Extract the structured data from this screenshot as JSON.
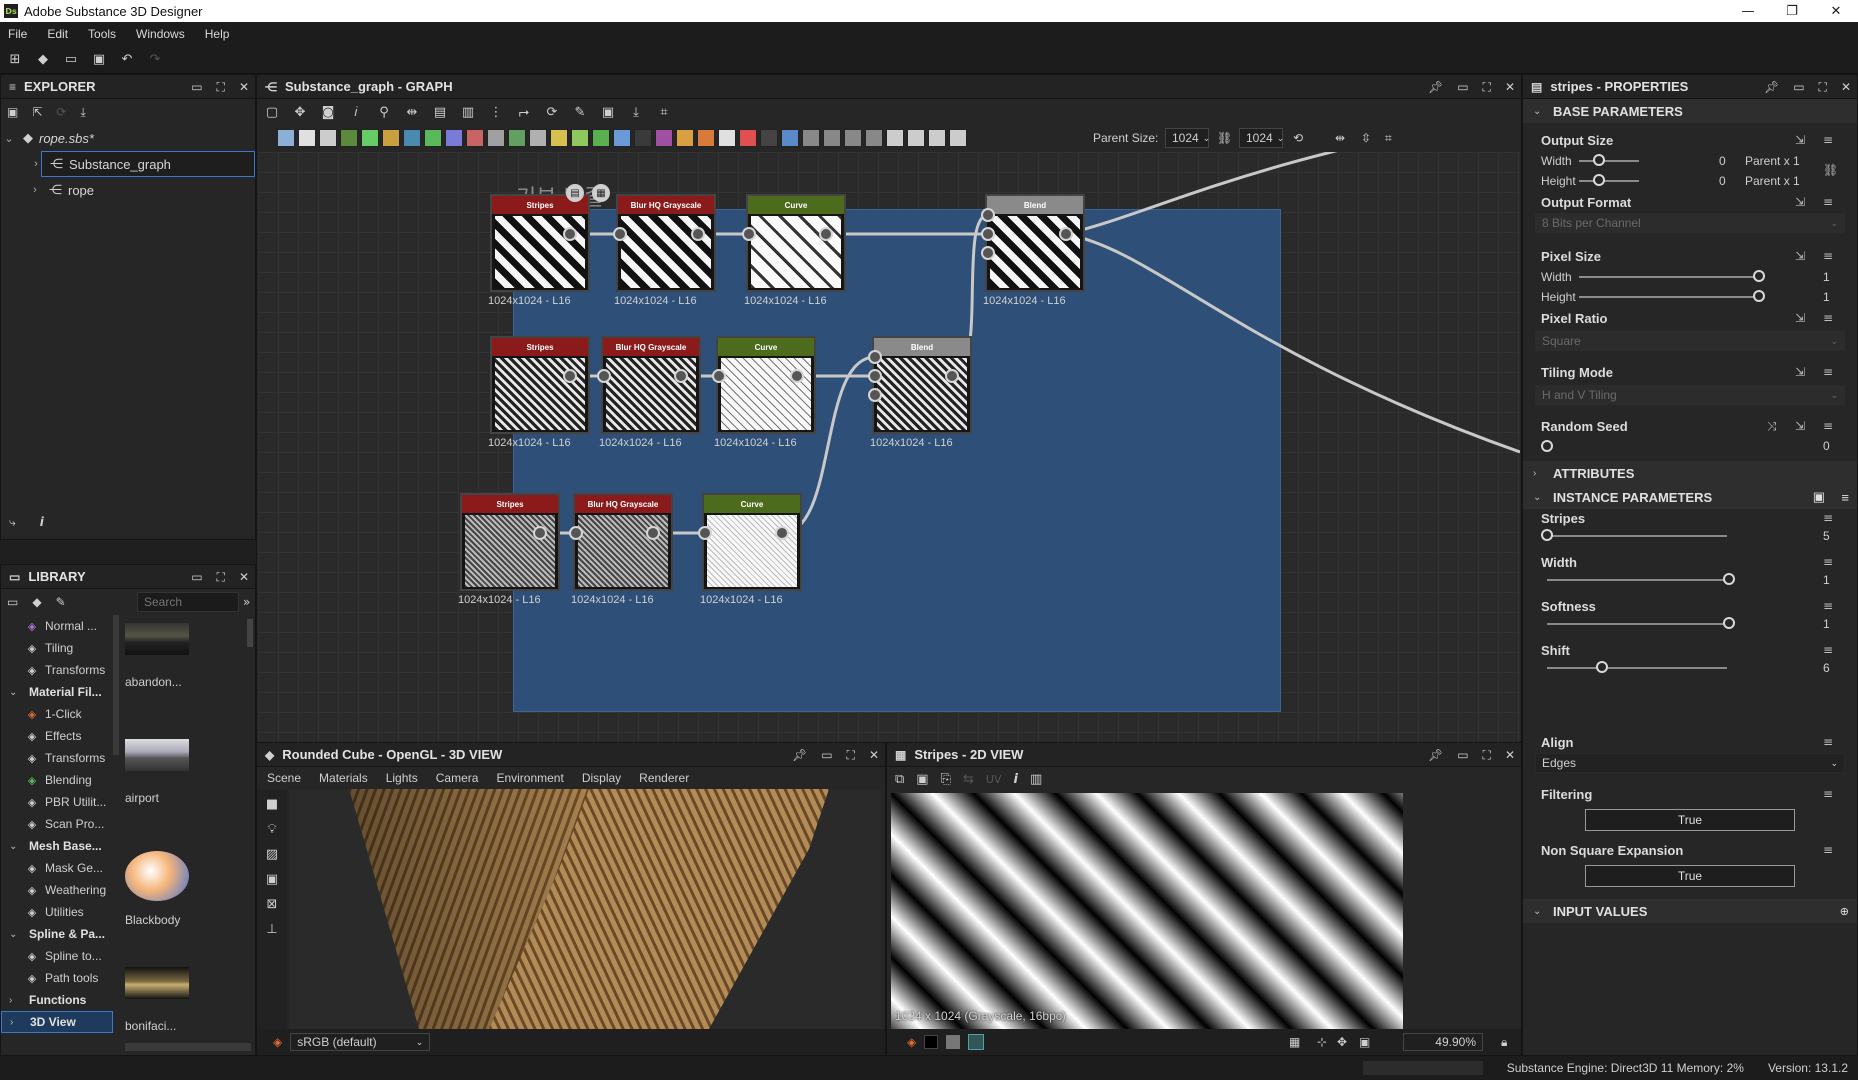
{
  "window": {
    "title": "Adobe Substance 3D Designer",
    "app_badge": "Ds",
    "minimize": "—",
    "restore": "❐",
    "close": "✕"
  },
  "menu": [
    "File",
    "Edit",
    "Tools",
    "Windows",
    "Help"
  ],
  "explorer": {
    "title": "EXPLORER",
    "package": "rope.sbs*",
    "items": [
      "Substance_graph",
      "rope"
    ]
  },
  "library": {
    "title": "LIBRARY",
    "search_placeholder": "Search",
    "categories": [
      {
        "label": "Normal ...",
        "type": "item",
        "color": "#a874d8"
      },
      {
        "label": "Tiling",
        "type": "item",
        "color": "#cfcfcf"
      },
      {
        "label": "Transforms",
        "type": "item",
        "color": "#cfcfcf"
      },
      {
        "label": "Material Fil...",
        "type": "cat"
      },
      {
        "label": "1-Click",
        "type": "item",
        "color": "#d66a3c"
      },
      {
        "label": "Effects",
        "type": "item",
        "color": "#cfcfcf"
      },
      {
        "label": "Transforms",
        "type": "item",
        "color": "#cfcfcf"
      },
      {
        "label": "Blending",
        "type": "item",
        "color": "#5ab85c"
      },
      {
        "label": "PBR Utilit...",
        "type": "item",
        "color": "#cfcfcf"
      },
      {
        "label": "Scan Pro...",
        "type": "item",
        "color": "#cfcfcf"
      },
      {
        "label": "Mesh Base...",
        "type": "cat"
      },
      {
        "label": "Mask Ge...",
        "type": "item",
        "color": "#cfcfcf"
      },
      {
        "label": "Weathering",
        "type": "item",
        "color": "#cfcfcf"
      },
      {
        "label": "Utilities",
        "type": "item",
        "color": "#cfcfcf"
      },
      {
        "label": "Spline & Pa...",
        "type": "cat"
      },
      {
        "label": "Spline to...",
        "type": "item",
        "color": "#cfcfcf"
      },
      {
        "label": "Path tools",
        "type": "item",
        "color": "#cfcfcf"
      },
      {
        "label": "Functions",
        "type": "cat"
      },
      {
        "label": "3D View",
        "type": "cat"
      }
    ],
    "thumbs": [
      "abandon...",
      "airport",
      "Blackbody",
      "bonifaci..."
    ]
  },
  "graph": {
    "title": "Substance_graph - GRAPH",
    "parent_size_label": "Parent Size:",
    "parent_size_w": "1024",
    "parent_size_h": "1024",
    "frame_title": "기본 밧줄",
    "nodes": [
      {
        "id": "n1",
        "title": "Stripes",
        "color": "#8b1a1a",
        "label": "1024x1024 - L16",
        "pattern": "coarse"
      },
      {
        "id": "n2",
        "title": "Blur HQ Grayscale",
        "color": "#8b1a1a",
        "label": "1024x1024 - L16",
        "pattern": "coarse"
      },
      {
        "id": "n3",
        "title": "Curve",
        "color": "#4d6b1c",
        "label": "1024x1024 - L16",
        "pattern": "curve"
      },
      {
        "id": "n4",
        "title": "Blend",
        "color": "#8a8a8a",
        "label": "1024x1024 - L16",
        "pattern": "coarse"
      },
      {
        "id": "n5",
        "title": "Stripes",
        "color": "#8b1a1a",
        "label": "1024x1024 - L16",
        "pattern": "fine"
      },
      {
        "id": "n6",
        "title": "Blur HQ Grayscale",
        "color": "#8b1a1a",
        "label": "1024x1024 - L16",
        "pattern": "fine"
      },
      {
        "id": "n7",
        "title": "Curve",
        "color": "#4d6b1c",
        "label": "1024x1024 - L16",
        "pattern": "fine-curve"
      },
      {
        "id": "n8",
        "title": "Blend",
        "color": "#8a8a8a",
        "label": "1024x1024 - L16",
        "pattern": "fine"
      },
      {
        "id": "n9",
        "title": "Stripes",
        "color": "#8b1a1a",
        "label": "1024x1024 - L16",
        "pattern": "tiny"
      },
      {
        "id": "n10",
        "title": "Blur HQ Grayscale",
        "color": "#8b1a1a",
        "label": "1024x1024 - L16",
        "pattern": "tiny"
      },
      {
        "id": "n11",
        "title": "Curve",
        "color": "#4d6b1c",
        "label": "1024x1024 - L16",
        "pattern": "tiny-curve"
      }
    ]
  },
  "view3d": {
    "title": "Rounded Cube - OpenGL - 3D VIEW",
    "tabs": [
      "Scene",
      "Materials",
      "Lights",
      "Camera",
      "Environment",
      "Display",
      "Renderer"
    ],
    "colorspace": "sRGB (default)"
  },
  "view2d": {
    "title": "Stripes - 2D VIEW",
    "uv_label": "UV",
    "info": "1024 x 1024 (Grayscale, 16bpc)",
    "zoom": "49.90%"
  },
  "properties": {
    "title": "stripes - PROPERTIES",
    "sections": {
      "base": "BASE PARAMETERS",
      "attributes": "ATTRIBUTES",
      "instance": "INSTANCE PARAMETERS",
      "input": "INPUT VALUES"
    },
    "output_size": {
      "label": "Output Size",
      "width_label": "Width",
      "height_label": "Height",
      "width_val": "0",
      "height_val": "0",
      "width_mode": "Parent x 1",
      "height_mode": "Parent x 1"
    },
    "output_format": {
      "label": "Output Format",
      "value": "8 Bits per Channel"
    },
    "pixel_size": {
      "label": "Pixel Size",
      "width_label": "Width",
      "height_label": "Height",
      "width_val": "1",
      "height_val": "1"
    },
    "pixel_ratio": {
      "label": "Pixel Ratio",
      "value": "Square"
    },
    "tiling_mode": {
      "label": "Tiling Mode",
      "value": "H and V Tiling"
    },
    "random_seed": {
      "label": "Random Seed",
      "value": "0"
    },
    "stripes": {
      "label": "Stripes",
      "value": "5",
      "fraction": 0.0
    },
    "width": {
      "label": "Width",
      "value": "1",
      "fraction": 1.0
    },
    "softness": {
      "label": "Softness",
      "value": "1",
      "fraction": 1.0
    },
    "shift": {
      "label": "Shift",
      "value": "6",
      "fraction": 0.3
    },
    "align": {
      "label": "Align",
      "value": "Edges"
    },
    "filtering": {
      "label": "Filtering",
      "value": "True"
    },
    "nonsquare": {
      "label": "Non Square Expansion",
      "value": "True"
    }
  },
  "status": {
    "engine": "Substance Engine: Direct3D 11  Memory: 2%",
    "version": "Version: 13.1.2"
  }
}
